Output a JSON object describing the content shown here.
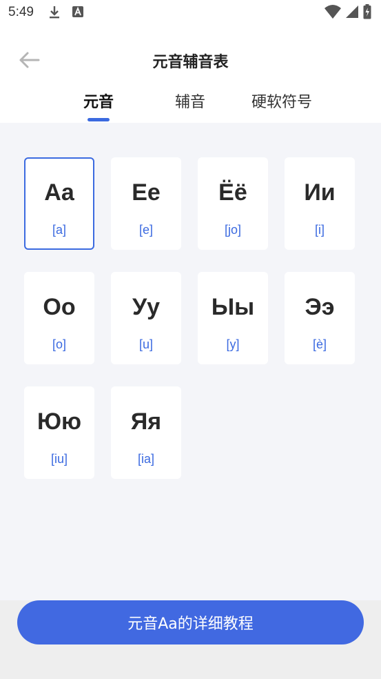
{
  "status": {
    "time": "5:49"
  },
  "header": {
    "title": "元音辅音表"
  },
  "tabs": [
    {
      "label": "元音"
    },
    {
      "label": "辅音"
    },
    {
      "label": "硬软符号"
    }
  ],
  "cards": [
    {
      "letter": "Aa",
      "transcription": "[a]"
    },
    {
      "letter": "Ee",
      "transcription": "[e]"
    },
    {
      "letter": "Ёё",
      "transcription": "[jo]"
    },
    {
      "letter": "Ии",
      "transcription": "[i]"
    },
    {
      "letter": "Оо",
      "transcription": "[o]"
    },
    {
      "letter": "Уу",
      "transcription": "[u]"
    },
    {
      "letter": "Ыы",
      "transcription": "[y]"
    },
    {
      "letter": "Ээ",
      "transcription": "[è]"
    },
    {
      "letter": "Юю",
      "transcription": "[iu]"
    },
    {
      "letter": "Яя",
      "transcription": "[ia]"
    }
  ],
  "cta": {
    "label": "元音Aa的详细教程"
  },
  "colors": {
    "accent": "#3b6ae0",
    "button": "#4169e1",
    "background": "#f4f5f9"
  }
}
